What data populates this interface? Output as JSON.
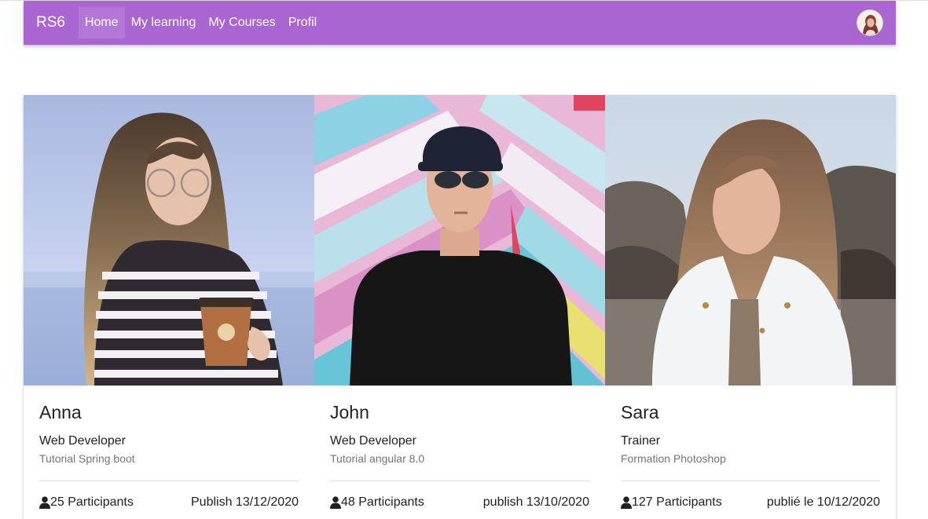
{
  "navbar": {
    "brand": "RS6",
    "items": [
      {
        "label": "Home",
        "active": true
      },
      {
        "label": "My learning",
        "active": false
      },
      {
        "label": "My Courses",
        "active": false
      },
      {
        "label": "Profil",
        "active": false
      }
    ],
    "accent_color": "#a966d0"
  },
  "cards": [
    {
      "name": "Anna",
      "role": "Web Developer",
      "course": "Tutorial Spring boot",
      "participants": "25 Participants",
      "publish": "Publish 13/12/2020"
    },
    {
      "name": "John",
      "role": "Web Developer",
      "course": "Tutorial angular 8.0",
      "participants": "48 Participants",
      "publish": "publish 13/10/2020"
    },
    {
      "name": "Sara",
      "role": "Trainer",
      "course": "Formation Photoshop",
      "participants": "127 Participants",
      "publish": "publié le 10/12/2020"
    }
  ]
}
